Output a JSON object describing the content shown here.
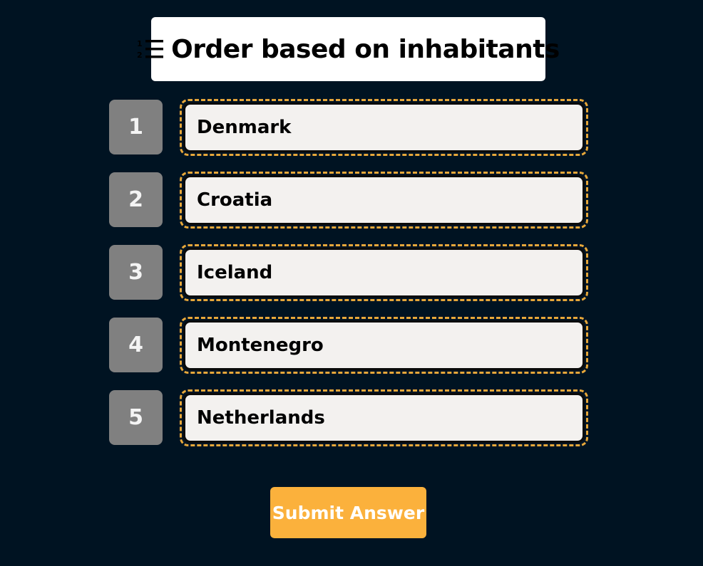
{
  "title": {
    "icon": "ordered-list-icon",
    "text": "Order based on inhabitants"
  },
  "colors": {
    "background": "#001322",
    "rank_badge": "#808080",
    "slot_border": "#e7a73a",
    "item_background": "#f3f1ef",
    "submit_button": "#fbb13c"
  },
  "rows": [
    {
      "rank": "1",
      "item": "Denmark"
    },
    {
      "rank": "2",
      "item": "Croatia"
    },
    {
      "rank": "3",
      "item": "Iceland"
    },
    {
      "rank": "4",
      "item": "Montenegro"
    },
    {
      "rank": "5",
      "item": "Netherlands"
    }
  ],
  "submit": {
    "label": "Submit Answer"
  }
}
